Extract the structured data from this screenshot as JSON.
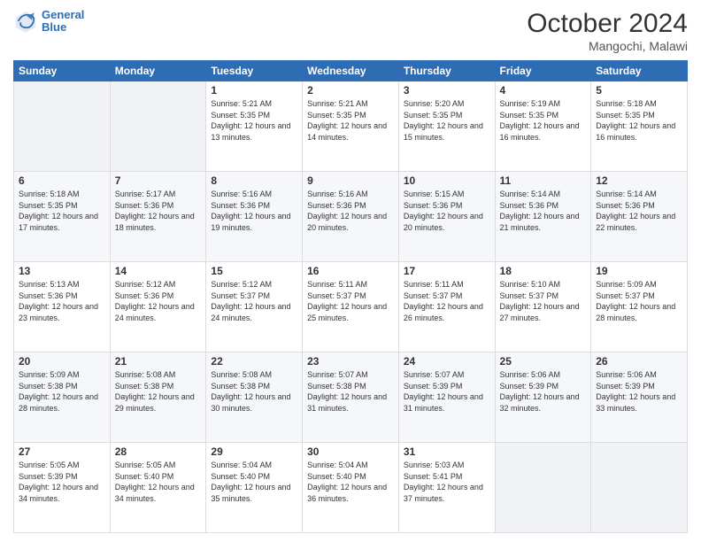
{
  "logo": {
    "line1": "General",
    "line2": "Blue"
  },
  "header": {
    "month": "October 2024",
    "location": "Mangochi, Malawi"
  },
  "weekdays": [
    "Sunday",
    "Monday",
    "Tuesday",
    "Wednesday",
    "Thursday",
    "Friday",
    "Saturday"
  ],
  "weeks": [
    [
      {
        "day": null
      },
      {
        "day": null
      },
      {
        "day": "1",
        "sunrise": "Sunrise: 5:21 AM",
        "sunset": "Sunset: 5:35 PM",
        "daylight": "Daylight: 12 hours and 13 minutes."
      },
      {
        "day": "2",
        "sunrise": "Sunrise: 5:21 AM",
        "sunset": "Sunset: 5:35 PM",
        "daylight": "Daylight: 12 hours and 14 minutes."
      },
      {
        "day": "3",
        "sunrise": "Sunrise: 5:20 AM",
        "sunset": "Sunset: 5:35 PM",
        "daylight": "Daylight: 12 hours and 15 minutes."
      },
      {
        "day": "4",
        "sunrise": "Sunrise: 5:19 AM",
        "sunset": "Sunset: 5:35 PM",
        "daylight": "Daylight: 12 hours and 16 minutes."
      },
      {
        "day": "5",
        "sunrise": "Sunrise: 5:18 AM",
        "sunset": "Sunset: 5:35 PM",
        "daylight": "Daylight: 12 hours and 16 minutes."
      }
    ],
    [
      {
        "day": "6",
        "sunrise": "Sunrise: 5:18 AM",
        "sunset": "Sunset: 5:35 PM",
        "daylight": "Daylight: 12 hours and 17 minutes."
      },
      {
        "day": "7",
        "sunrise": "Sunrise: 5:17 AM",
        "sunset": "Sunset: 5:36 PM",
        "daylight": "Daylight: 12 hours and 18 minutes."
      },
      {
        "day": "8",
        "sunrise": "Sunrise: 5:16 AM",
        "sunset": "Sunset: 5:36 PM",
        "daylight": "Daylight: 12 hours and 19 minutes."
      },
      {
        "day": "9",
        "sunrise": "Sunrise: 5:16 AM",
        "sunset": "Sunset: 5:36 PM",
        "daylight": "Daylight: 12 hours and 20 minutes."
      },
      {
        "day": "10",
        "sunrise": "Sunrise: 5:15 AM",
        "sunset": "Sunset: 5:36 PM",
        "daylight": "Daylight: 12 hours and 20 minutes."
      },
      {
        "day": "11",
        "sunrise": "Sunrise: 5:14 AM",
        "sunset": "Sunset: 5:36 PM",
        "daylight": "Daylight: 12 hours and 21 minutes."
      },
      {
        "day": "12",
        "sunrise": "Sunrise: 5:14 AM",
        "sunset": "Sunset: 5:36 PM",
        "daylight": "Daylight: 12 hours and 22 minutes."
      }
    ],
    [
      {
        "day": "13",
        "sunrise": "Sunrise: 5:13 AM",
        "sunset": "Sunset: 5:36 PM",
        "daylight": "Daylight: 12 hours and 23 minutes."
      },
      {
        "day": "14",
        "sunrise": "Sunrise: 5:12 AM",
        "sunset": "Sunset: 5:36 PM",
        "daylight": "Daylight: 12 hours and 24 minutes."
      },
      {
        "day": "15",
        "sunrise": "Sunrise: 5:12 AM",
        "sunset": "Sunset: 5:37 PM",
        "daylight": "Daylight: 12 hours and 24 minutes."
      },
      {
        "day": "16",
        "sunrise": "Sunrise: 5:11 AM",
        "sunset": "Sunset: 5:37 PM",
        "daylight": "Daylight: 12 hours and 25 minutes."
      },
      {
        "day": "17",
        "sunrise": "Sunrise: 5:11 AM",
        "sunset": "Sunset: 5:37 PM",
        "daylight": "Daylight: 12 hours and 26 minutes."
      },
      {
        "day": "18",
        "sunrise": "Sunrise: 5:10 AM",
        "sunset": "Sunset: 5:37 PM",
        "daylight": "Daylight: 12 hours and 27 minutes."
      },
      {
        "day": "19",
        "sunrise": "Sunrise: 5:09 AM",
        "sunset": "Sunset: 5:37 PM",
        "daylight": "Daylight: 12 hours and 28 minutes."
      }
    ],
    [
      {
        "day": "20",
        "sunrise": "Sunrise: 5:09 AM",
        "sunset": "Sunset: 5:38 PM",
        "daylight": "Daylight: 12 hours and 28 minutes."
      },
      {
        "day": "21",
        "sunrise": "Sunrise: 5:08 AM",
        "sunset": "Sunset: 5:38 PM",
        "daylight": "Daylight: 12 hours and 29 minutes."
      },
      {
        "day": "22",
        "sunrise": "Sunrise: 5:08 AM",
        "sunset": "Sunset: 5:38 PM",
        "daylight": "Daylight: 12 hours and 30 minutes."
      },
      {
        "day": "23",
        "sunrise": "Sunrise: 5:07 AM",
        "sunset": "Sunset: 5:38 PM",
        "daylight": "Daylight: 12 hours and 31 minutes."
      },
      {
        "day": "24",
        "sunrise": "Sunrise: 5:07 AM",
        "sunset": "Sunset: 5:39 PM",
        "daylight": "Daylight: 12 hours and 31 minutes."
      },
      {
        "day": "25",
        "sunrise": "Sunrise: 5:06 AM",
        "sunset": "Sunset: 5:39 PM",
        "daylight": "Daylight: 12 hours and 32 minutes."
      },
      {
        "day": "26",
        "sunrise": "Sunrise: 5:06 AM",
        "sunset": "Sunset: 5:39 PM",
        "daylight": "Daylight: 12 hours and 33 minutes."
      }
    ],
    [
      {
        "day": "27",
        "sunrise": "Sunrise: 5:05 AM",
        "sunset": "Sunset: 5:39 PM",
        "daylight": "Daylight: 12 hours and 34 minutes."
      },
      {
        "day": "28",
        "sunrise": "Sunrise: 5:05 AM",
        "sunset": "Sunset: 5:40 PM",
        "daylight": "Daylight: 12 hours and 34 minutes."
      },
      {
        "day": "29",
        "sunrise": "Sunrise: 5:04 AM",
        "sunset": "Sunset: 5:40 PM",
        "daylight": "Daylight: 12 hours and 35 minutes."
      },
      {
        "day": "30",
        "sunrise": "Sunrise: 5:04 AM",
        "sunset": "Sunset: 5:40 PM",
        "daylight": "Daylight: 12 hours and 36 minutes."
      },
      {
        "day": "31",
        "sunrise": "Sunrise: 5:03 AM",
        "sunset": "Sunset: 5:41 PM",
        "daylight": "Daylight: 12 hours and 37 minutes."
      },
      {
        "day": null
      },
      {
        "day": null
      }
    ]
  ]
}
